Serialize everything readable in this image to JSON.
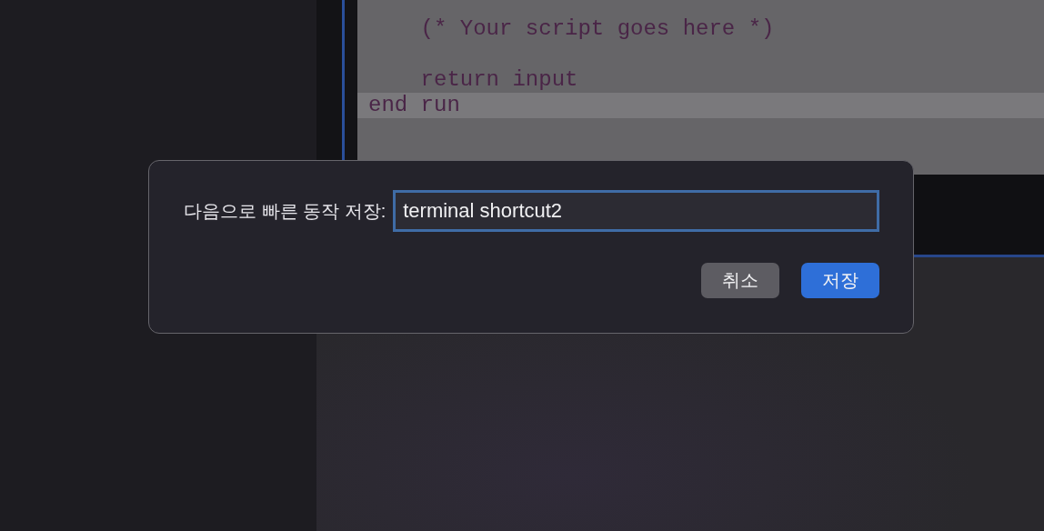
{
  "editor": {
    "lines": [
      {
        "text": "    (* Your script goes here *)",
        "selected": false
      },
      {
        "selected": false
      },
      {
        "text": "    return input",
        "selected": false
      },
      {
        "text": "end run",
        "selected": true
      }
    ]
  },
  "dialog": {
    "label": "다음으로 빠른 동작 저장:",
    "input": {
      "value": "terminal shortcut2",
      "focused": true
    },
    "buttons": [
      {
        "label": "취소",
        "kind": "secondary"
      },
      {
        "label": "저장",
        "kind": "primary"
      }
    ]
  }
}
